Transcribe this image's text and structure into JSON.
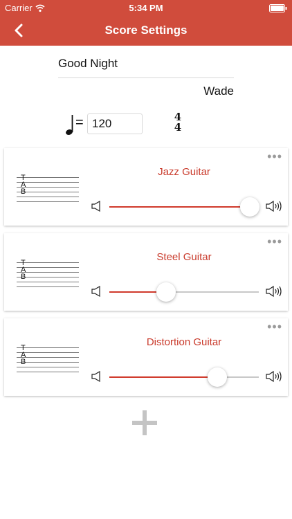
{
  "status_bar": {
    "carrier": "Carrier",
    "time": "5:34 PM"
  },
  "header": {
    "title": "Score Settings"
  },
  "score": {
    "name": "Good Night",
    "artist": "Wade"
  },
  "tempo": {
    "equals": "=",
    "bpm": "120",
    "time_sig_top": "4",
    "time_sig_bottom": "4"
  },
  "tracks": [
    {
      "name": "Jazz Guitar",
      "volume": 0.94
    },
    {
      "name": "Steel Guitar",
      "volume": 0.38
    },
    {
      "name": "Distortion Guitar",
      "volume": 0.72
    }
  ],
  "tab_label": {
    "t": "T",
    "a": "A",
    "b": "B"
  },
  "more_label": "•••",
  "colors": {
    "header_bg": "#D04C3C",
    "accent": "#C93A2B",
    "slider_fill": "#D0392B"
  },
  "icons": [
    "back-chevron-icon",
    "wifi-icon",
    "battery-icon",
    "quarter-note-icon",
    "volume-low-icon",
    "volume-high-icon",
    "more-icon",
    "plus-icon"
  ]
}
